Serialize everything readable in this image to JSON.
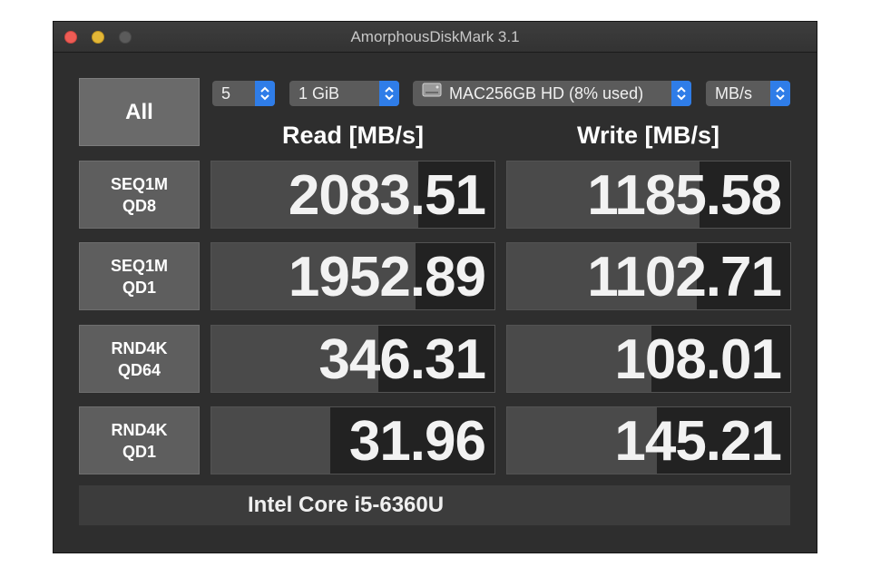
{
  "window": {
    "title": "AmorphousDiskMark 3.1"
  },
  "controls": {
    "all_label": "All",
    "count_value": "5",
    "size_value": "1 GiB",
    "disk_value": "MAC256GB HD (8% used)",
    "unit_value": "MB/s"
  },
  "headers": {
    "read": "Read [MB/s]",
    "write": "Write [MB/s]"
  },
  "tests": [
    {
      "line1": "SEQ1M",
      "line2": "QD8",
      "read": "2083.51",
      "write": "1185.58",
      "read_fill": 0.73,
      "write_fill": 0.68
    },
    {
      "line1": "SEQ1M",
      "line2": "QD1",
      "read": "1952.89",
      "write": "1102.71",
      "read_fill": 0.72,
      "write_fill": 0.67
    },
    {
      "line1": "RND4K",
      "line2": "QD64",
      "read": "346.31",
      "write": "108.01",
      "read_fill": 0.59,
      "write_fill": 0.51
    },
    {
      "line1": "RND4K",
      "line2": "QD1",
      "read": "31.96",
      "write": "145.21",
      "read_fill": 0.42,
      "write_fill": 0.53
    }
  ],
  "footer": {
    "cpu": "Intel Core i5-6360U"
  },
  "icons": {
    "stepper": "up-down-chevron-icon",
    "disk": "hard-disk-icon"
  },
  "colors": {
    "accent": "#2f7de8",
    "bar": "#4a4a4a",
    "cell_bg": "#222222"
  }
}
